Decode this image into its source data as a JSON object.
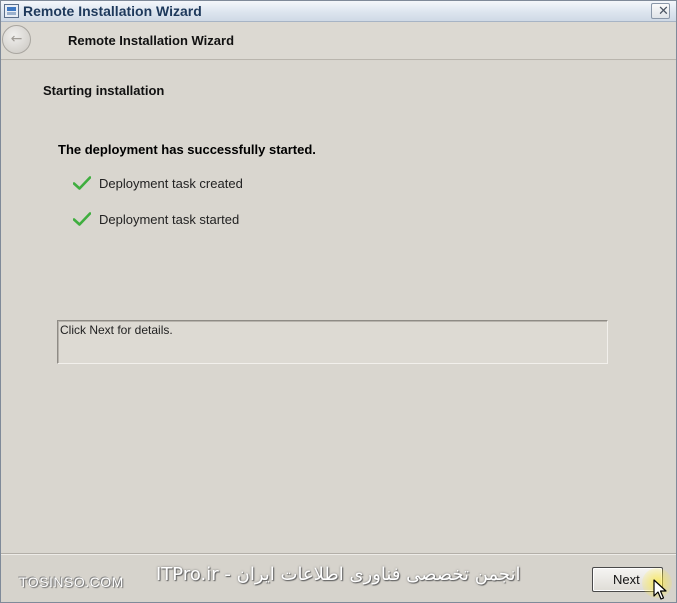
{
  "window": {
    "title": "Remote Installation Wizard",
    "close_glyph": "✕"
  },
  "navbar": {
    "back_glyph": "←",
    "title": "Remote Installation Wizard"
  },
  "content": {
    "section_heading": "Starting installation",
    "status_heading": "The deployment has successfully started.",
    "tasks": [
      {
        "label": "Deployment task created",
        "icon": "green-check-icon"
      },
      {
        "label": "Deployment task started",
        "icon": "green-check-icon"
      }
    ],
    "details_text": "Click Next for details."
  },
  "footer": {
    "watermark_left": "TOSINSO.COM",
    "watermark_center": "انجمن تخصصی فناوری اطلاعات ایران - ITPro.ir",
    "next_label": "Next"
  },
  "colors": {
    "check_green": "#3fae3f",
    "cursor_highlight": "#ffeb3c"
  }
}
